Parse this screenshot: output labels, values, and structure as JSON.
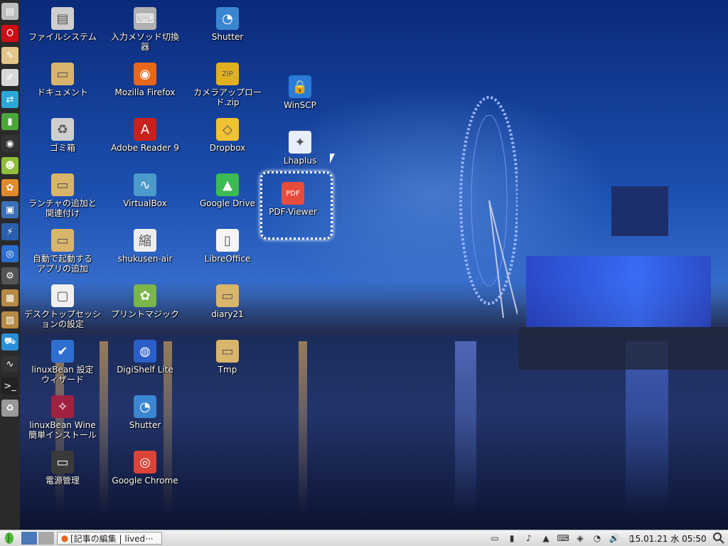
{
  "desktop": {
    "icons": [
      {
        "label": "ファイルシステム",
        "icon": "drive-icon",
        "color": "#cfcfcf"
      },
      {
        "label": "入力メソッド切換\n器",
        "icon": "keyboard-icon",
        "color": "#b0b0b0"
      },
      {
        "label": "Shutter",
        "icon": "shutter-icon",
        "color": "#3a86d1"
      },
      {
        "label": "ドキュメント",
        "icon": "folder-icon",
        "color": "#d9b46b"
      },
      {
        "label": "Mozilla Firefox",
        "icon": "firefox-icon",
        "color": "#e8671b"
      },
      {
        "label": "カメラアップロー\nド.zip",
        "icon": "zip-icon",
        "color": "#e0b020"
      },
      {
        "label": "WinSCP",
        "icon": "winscp-icon",
        "color": "#2a7cd6"
      },
      {
        "label": "ゴミ箱",
        "icon": "trash-icon",
        "color": "#cfcfcf"
      },
      {
        "label": "Adobe Reader 9",
        "icon": "adobe-reader-icon",
        "color": "#c8221c"
      },
      {
        "label": "Dropbox",
        "icon": "dropbox-icon",
        "color": "#f1c232"
      },
      {
        "label": "Lhaplus",
        "icon": "lhaplus-icon",
        "color": "#e8eefc"
      },
      {
        "label": "ランチャの追加と\n関連付け",
        "icon": "folder-icon",
        "color": "#d9b46b"
      },
      {
        "label": "VirtualBox",
        "icon": "virtualbox-icon",
        "color": "#4b9acb"
      },
      {
        "label": "Google Drive",
        "icon": "google-drive-icon",
        "color": "#3cba54"
      },
      {
        "label": "PDF-Viewer",
        "icon": "pdf-viewer-icon",
        "color": "#e74c3c"
      },
      {
        "label": "自動で起動する\nアプリの追加",
        "icon": "folder-icon",
        "color": "#d9b46b"
      },
      {
        "label": "shukusen-air",
        "icon": "shukusen-icon",
        "color": "#eeeeee"
      },
      {
        "label": "LibreOffice",
        "icon": "libreoffice-icon",
        "color": "#f5f5f5"
      },
      {
        "label": "デスクトップセッシ\nョンの設定",
        "icon": "session-icon",
        "color": "#f0f0f0"
      },
      {
        "label": "プリントマジック",
        "icon": "printmagic-icon",
        "color": "#7ab648"
      },
      {
        "label": "diary21",
        "icon": "folder-icon",
        "color": "#d9b46b"
      },
      {
        "label": "linuxBean 設定\nウィザード",
        "icon": "wizard-icon",
        "color": "#2e6fd0"
      },
      {
        "label": "DigiShelf Lite",
        "icon": "digishelf-icon",
        "color": "#2b5fc9"
      },
      {
        "label": "Tmp",
        "icon": "folder-icon",
        "color": "#d9b46b"
      },
      {
        "label": "linuxBean Wine\n簡単インストール",
        "icon": "wine-icon",
        "color": "#a02040"
      },
      {
        "label": "Shutter",
        "icon": "shutter-icon",
        "color": "#3a86d1"
      },
      {
        "label": "電源管理",
        "icon": "battery-icon",
        "color": "#3a3a3a"
      },
      {
        "label": "Google Chrome",
        "icon": "chrome-icon",
        "color": "#db4437"
      }
    ]
  },
  "launcher": {
    "items": [
      {
        "icon": "drive-icon",
        "color": "#bdbdbd",
        "glyph": "▤"
      },
      {
        "icon": "opera-icon",
        "color": "#cc0f16",
        "glyph": "O"
      },
      {
        "icon": "notes-icon",
        "color": "#e2c68a",
        "glyph": "✎"
      },
      {
        "icon": "text-editor-icon",
        "color": "#d8d8d8",
        "glyph": "✐"
      },
      {
        "icon": "network-icon",
        "color": "#2aa7d8",
        "glyph": "⇄"
      },
      {
        "icon": "green-app-icon",
        "color": "#4aa53a",
        "glyph": "▮"
      },
      {
        "icon": "camera-icon",
        "color": "#333333",
        "glyph": "◉"
      },
      {
        "icon": "frog-icon",
        "color": "#8fbf3a",
        "glyph": "☻"
      },
      {
        "icon": "paint-icon",
        "color": "#e08a2c",
        "glyph": "✿"
      },
      {
        "icon": "image-viewer-icon",
        "color": "#3c6fb8",
        "glyph": "▣"
      },
      {
        "icon": "lightning-icon",
        "color": "#2a5fb0",
        "glyph": "⚡"
      },
      {
        "icon": "wireless-icon",
        "color": "#2a6fcf",
        "glyph": "◎"
      },
      {
        "icon": "settings-icon",
        "color": "#555555",
        "glyph": "⚙"
      },
      {
        "icon": "package-icon",
        "color": "#b58a45",
        "glyph": "▦"
      },
      {
        "icon": "installer-icon",
        "color": "#b58a45",
        "glyph": "▧"
      },
      {
        "icon": "cart-icon",
        "color": "#2a8fd8",
        "glyph": "⛟"
      },
      {
        "icon": "monitor-icon",
        "color": "#333333",
        "glyph": "∿"
      },
      {
        "icon": "terminal-icon",
        "color": "#222222",
        "glyph": ">_"
      },
      {
        "icon": "trash-icon",
        "color": "#999999",
        "glyph": "♻"
      }
    ]
  },
  "taskbar": {
    "menu_icon": "bean-menu-icon",
    "workspace_colors": [
      "#4a78b8",
      "#a8a8a8"
    ],
    "task_label": "[記事の編集 | lived···",
    "task_icon": "firefox-icon",
    "tray": [
      "battery-icon",
      "signal-icon",
      "volume-icon",
      "drive-icon",
      "keyboard-icon",
      "wifi-icon",
      "shutter-icon",
      "speaker-icon",
      "clipboard-icon"
    ],
    "clock": "15.01.21 水 05:50",
    "search_icon": "magnifier-icon"
  }
}
